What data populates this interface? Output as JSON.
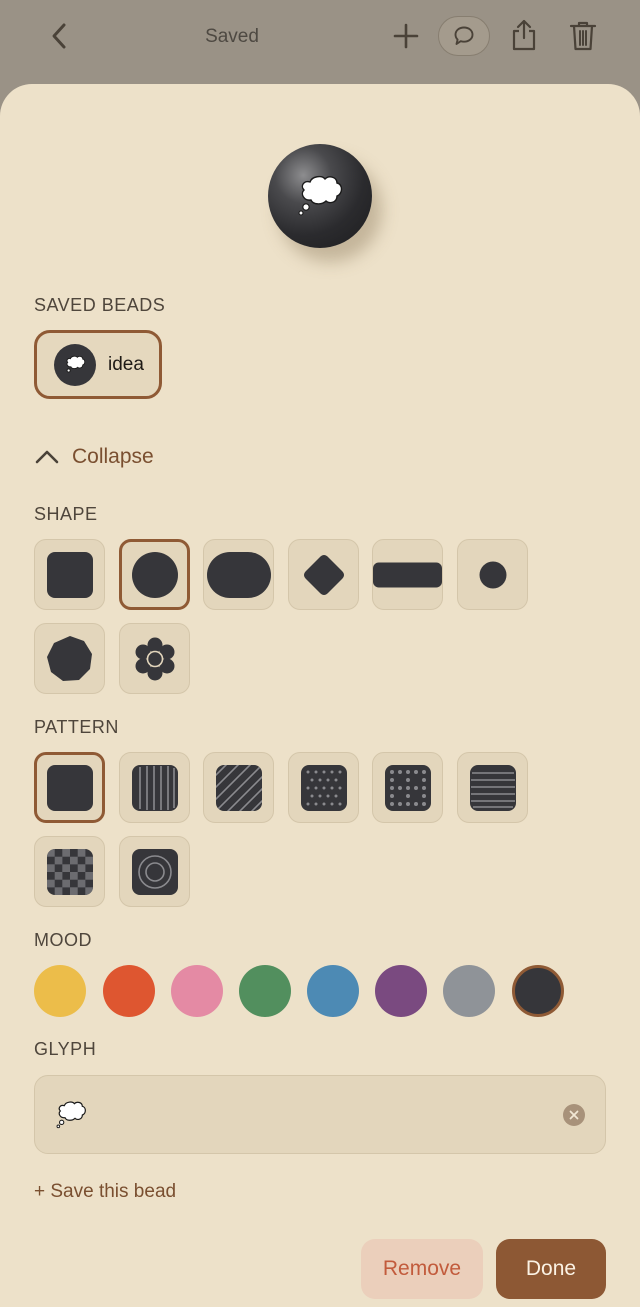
{
  "header": {
    "title": "Saved",
    "back_icon": "chevron-left-icon",
    "add_icon": "plus-icon",
    "comment_icon": "speech-bubble-icon",
    "share_icon": "share-icon",
    "delete_icon": "trash-icon"
  },
  "preview": {
    "glyph": "💭",
    "color": "#2b2b2e"
  },
  "saved_beads": {
    "label": "SAVED BEADS",
    "items": [
      {
        "name": "idea",
        "glyph": "💭"
      }
    ]
  },
  "collapse": {
    "label": "Collapse"
  },
  "shape": {
    "label": "SHAPE",
    "options": [
      "square",
      "circle",
      "pill",
      "diamond",
      "bar",
      "dot",
      "polygon",
      "flower"
    ],
    "selected": "circle"
  },
  "pattern": {
    "label": "PATTERN",
    "options": [
      "solid",
      "vertical-stripes",
      "diagonal-stripes",
      "dots",
      "grid-dots",
      "horizontal-stripes",
      "checker",
      "rings"
    ],
    "selected": "solid"
  },
  "mood": {
    "label": "MOOD",
    "colors": [
      "#ecbd4a",
      "#de5630",
      "#e48aa4",
      "#528f5e",
      "#4d8ab4",
      "#7a4a80",
      "#8f9398",
      "#36363a"
    ],
    "selected": "#36363a",
    "selected_ring": "#8f5a35"
  },
  "glyph": {
    "label": "GLYPH",
    "value": "💭",
    "clear_icon": "clear-x-icon"
  },
  "actions": {
    "save_link": "+ Save this bead",
    "remove": "Remove",
    "done": "Done"
  }
}
